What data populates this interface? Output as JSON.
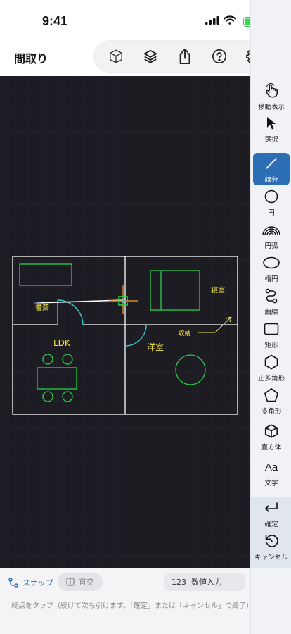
{
  "status": {
    "time": "9:41"
  },
  "header": {
    "title": "間取り",
    "toolbar": [
      "3d-cube-icon",
      "layers-icon",
      "share-icon",
      "help-icon",
      "settings-icon"
    ]
  },
  "tools": [
    {
      "label": "移動表示",
      "icon": "hand-pointer-icon"
    },
    {
      "label": "選択",
      "icon": "cursor-arrow-icon"
    },
    {
      "label": "線分",
      "icon": "line-segment-icon",
      "active": true
    },
    {
      "label": "円",
      "icon": "circle-icon"
    },
    {
      "label": "円弧",
      "icon": "arc-icon"
    },
    {
      "label": "楕円",
      "icon": "ellipse-icon"
    },
    {
      "label": "曲線",
      "icon": "curve-icon"
    },
    {
      "label": "矩形",
      "icon": "rectangle-icon"
    },
    {
      "label": "正多角形",
      "icon": "hexagon-icon"
    },
    {
      "label": "多角形",
      "icon": "pentagon-icon"
    },
    {
      "label": "直方体",
      "icon": "cuboid-icon"
    },
    {
      "label": "文字",
      "icon": "text-icon",
      "glyph": "Aa"
    },
    {
      "label": "確定",
      "icon": "enter-return-icon"
    },
    {
      "label": "キャンセル",
      "icon": "undo-cancel-icon"
    }
  ],
  "plan": {
    "rooms": {
      "study": "書斎",
      "bedroom": "寝室",
      "ldk": "LDK",
      "western": "洋室",
      "storage": "収納"
    },
    "colors": {
      "wall": "#ffffff",
      "furniture": "#27d14a",
      "text": "#f2e84a",
      "door": "#3cc7cf",
      "cursor": "#e08a2a",
      "grid": "#2a2b33"
    }
  },
  "bottom": {
    "snap": "スナップ",
    "ortho": "直交",
    "numeric": "123  数値入力",
    "hint": "終点をタップ（続けて次も引けます。「確定」または「キャンセル」で終了）"
  },
  "accent": "#2c6fb7"
}
